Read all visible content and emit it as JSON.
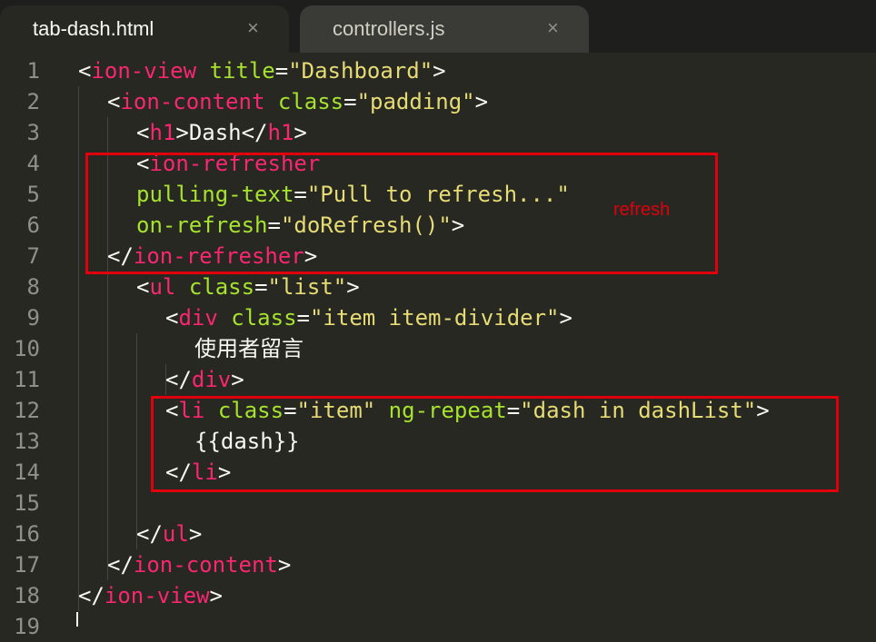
{
  "tabs": [
    {
      "label": "tab-dash.html",
      "close": "×",
      "active": true
    },
    {
      "label": "controllers.js",
      "close": "×",
      "active": false
    }
  ],
  "line_numbers": [
    "1",
    "2",
    "3",
    "4",
    "5",
    "6",
    "7",
    "8",
    "9",
    "10",
    "11",
    "12",
    "13",
    "14",
    "15",
    "16",
    "17",
    "18",
    "19"
  ],
  "code": {
    "l1": {
      "o": "<",
      "tag": "ion-view",
      "sp": " ",
      "attr": "title",
      "eq": "=",
      "val": "\"Dashboard\"",
      "c": ">"
    },
    "l2": {
      "o": "<",
      "tag": "ion-content",
      "sp": " ",
      "attr": "class",
      "eq": "=",
      "val": "\"padding\"",
      "c": ">"
    },
    "l3": {
      "o": "<",
      "tag": "h1",
      "c": ">",
      "text": "Dash",
      "o2": "</",
      "tag2": "h1",
      "c2": ">"
    },
    "l4": {
      "o": "<",
      "tag": "ion-refresher"
    },
    "l5": {
      "attr": "pulling-text",
      "eq": "=",
      "val": "\"Pull to refresh...\""
    },
    "l6": {
      "attr": "on-refresh",
      "eq": "=",
      "val": "\"doRefresh()\"",
      "c": ">"
    },
    "l7": {
      "o": "</",
      "tag": "ion-refresher",
      "c": ">"
    },
    "l8": {
      "o": "<",
      "tag": "ul",
      "sp": " ",
      "attr": "class",
      "eq": "=",
      "val": "\"list\"",
      "c": ">"
    },
    "l9": {
      "o": "<",
      "tag": "div",
      "sp": " ",
      "attr": "class",
      "eq": "=",
      "val": "\"item item-divider\"",
      "c": ">"
    },
    "l10": {
      "text": "使用者留言"
    },
    "l11": {
      "o": "</",
      "tag": "div",
      "c": ">"
    },
    "l12": {
      "o": "<",
      "tag": "li",
      "sp": " ",
      "attr": "class",
      "eq": "=",
      "val": "\"item\"",
      "sp2": " ",
      "attr2": "ng-repeat",
      "eq2": "=",
      "val2": "\"dash in dashList\"",
      "c": ">"
    },
    "l13": {
      "text": "{{dash}}"
    },
    "l14": {
      "o": "</",
      "tag": "li",
      "c": ">"
    },
    "l16": {
      "o": "</",
      "tag": "ul",
      "c": ">"
    },
    "l17": {
      "o": "</",
      "tag": "ion-content",
      "c": ">"
    },
    "l18": {
      "o": "</",
      "tag": "ion-view",
      "c": ">"
    }
  },
  "annotations": {
    "refresh_note": "refresh"
  },
  "colors": {
    "background": "#272822",
    "tag": "#f92672",
    "attribute": "#a6e22e",
    "string": "#e6db74",
    "text": "#f8f8f2",
    "line_number": "#8f908a",
    "highlight_box": "#e0000d"
  }
}
